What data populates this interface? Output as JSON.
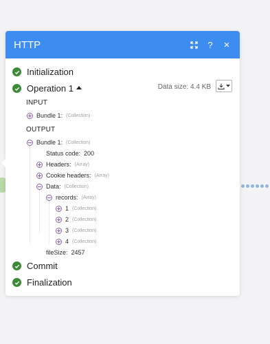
{
  "panel": {
    "title": "HTTP",
    "icons": [
      "expand-icon",
      "help-icon",
      "close-icon"
    ],
    "help_glyph": "?",
    "close_glyph": "×"
  },
  "steps": {
    "initialization": "Initialization",
    "operation": "Operation 1",
    "commit": "Commit",
    "finalization": "Finalization"
  },
  "data_size": "Data size: 4.4 KB",
  "input": {
    "heading": "INPUT",
    "bundle_key": "Bundle 1:",
    "bundle_type": "(Collection)"
  },
  "output": {
    "heading": "OUTPUT",
    "bundle_key": "Bundle 1:",
    "bundle_type": "(Collection)",
    "status_key": "Status code:",
    "status_value": "200",
    "headers_key": "Headers:",
    "headers_type": "(Array)",
    "cookie_key": "Cookie headers:",
    "cookie_type": "(Array)",
    "data_key": "Data:",
    "data_type": "(Collection)",
    "records_key": "records:",
    "records_type": "(Array)",
    "records": [
      {
        "key": "1",
        "type": "(Collection)"
      },
      {
        "key": "2",
        "type": "(Collection)"
      },
      {
        "key": "3",
        "type": "(Collection)"
      },
      {
        "key": "4",
        "type": "(Collection)"
      }
    ],
    "filesize_key": "fileSize:",
    "filesize_value": "2457"
  },
  "colors": {
    "header": "#3d8cf0",
    "success": "#3d8b37",
    "toggle": "#8a5fb0"
  }
}
